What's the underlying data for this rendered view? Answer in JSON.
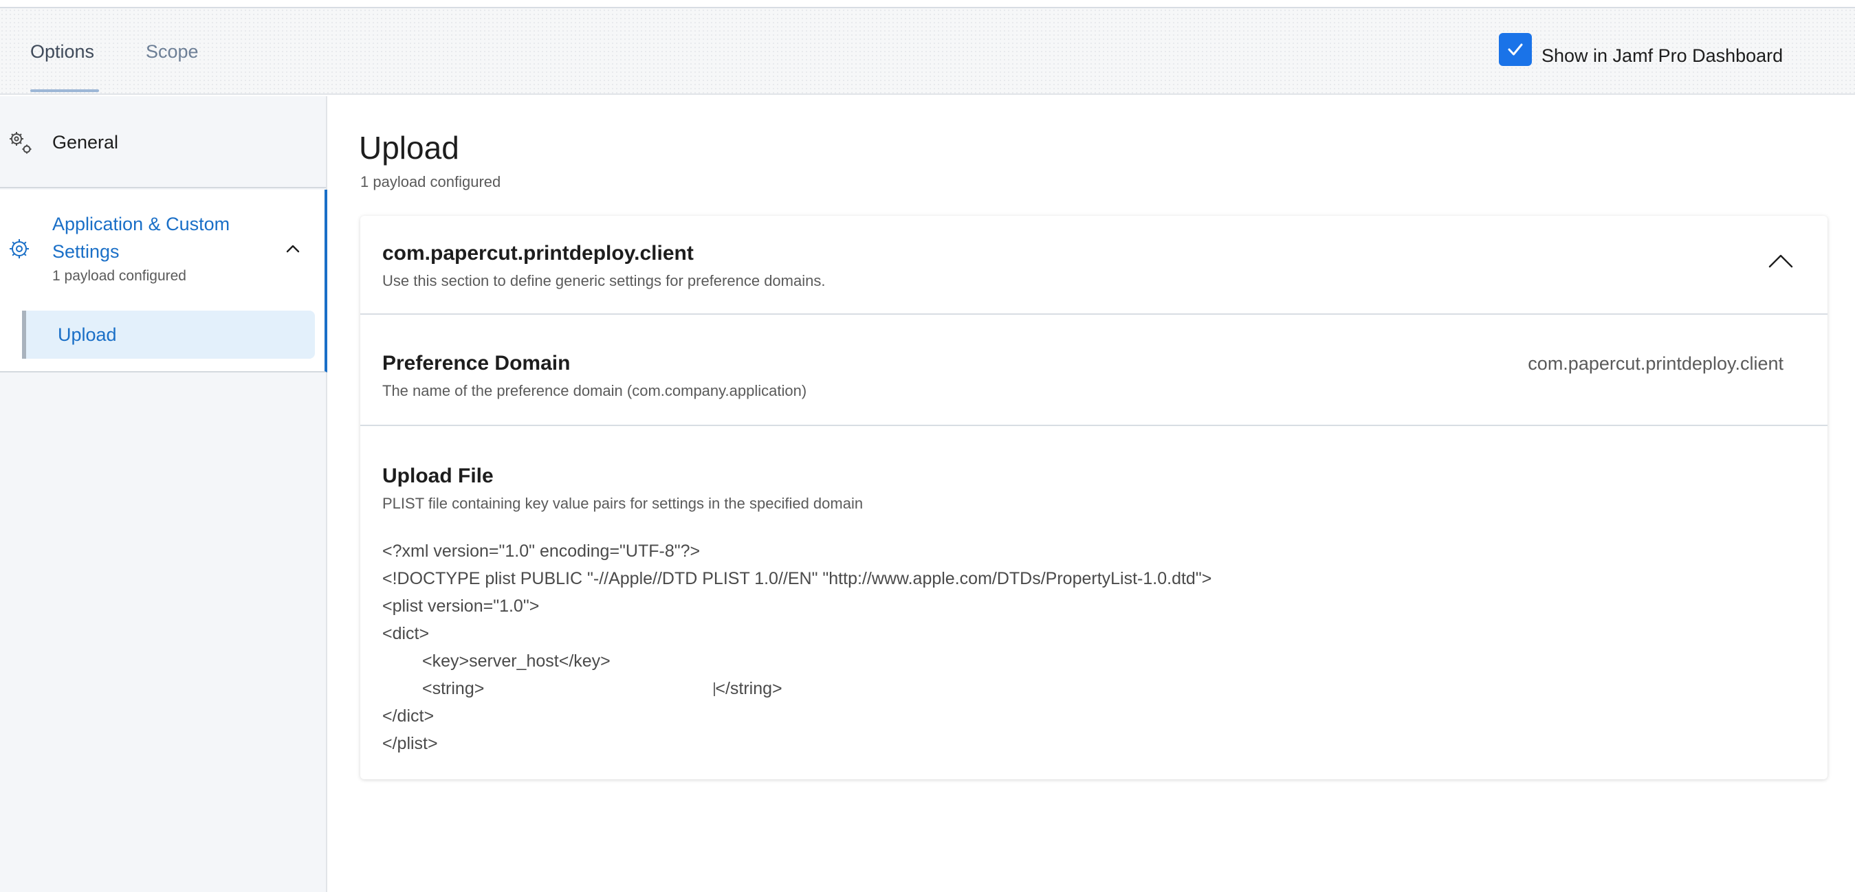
{
  "tabs": {
    "options": "Options",
    "scope": "Scope"
  },
  "dashboard": {
    "checked": true,
    "label": "Show in Jamf Pro Dashboard"
  },
  "sidebar": {
    "general": "General",
    "app_settings": {
      "title": "Application & Custom Settings",
      "subtitle": "1 payload configured",
      "expanded": true
    },
    "upload": "Upload"
  },
  "main": {
    "title": "Upload",
    "subtitle": "1 payload configured",
    "card": {
      "domain_title": "com.papercut.printdeploy.client",
      "domain_desc": "Use this section to define generic settings for preference domains.",
      "preference_domain": {
        "label": "Preference Domain",
        "desc": "The name of the preference domain (com.company.application)",
        "value": "com.papercut.printdeploy.client"
      },
      "upload_file": {
        "label": "Upload File",
        "desc": "PLIST file containing key value pairs for settings in the specified domain",
        "lines": {
          "xml": "<?xml version=\"1.0\" encoding=\"UTF-8\"?>",
          "doctype": "<!DOCTYPE plist PUBLIC \"-//Apple//DTD PLIST 1.0//EN\" \"http://www.apple.com/DTDs/PropertyList-1.0.dtd\">",
          "plist_open": "<plist version=\"1.0\">",
          "dict_open": "<dict>",
          "key": "<key>server_host</key>",
          "string_open": "<string>",
          "string_close": "</string>",
          "dict_close": "</dict>",
          "plist_close": "</plist>"
        }
      }
    }
  },
  "colors": {
    "accent": "#1a73e8",
    "link": "#1a6fc7"
  }
}
